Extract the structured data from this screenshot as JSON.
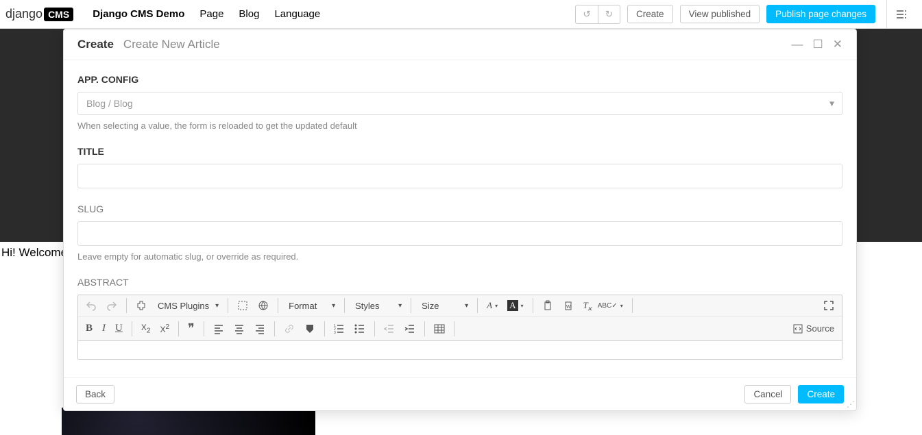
{
  "topbar": {
    "logo_text": "django",
    "logo_badge": "CMS",
    "nav": {
      "site_name": "Django CMS Demo",
      "page": "Page",
      "blog": "Blog",
      "language": "Language"
    },
    "buttons": {
      "create": "Create",
      "view_published": "View published",
      "publish": "Publish page changes"
    }
  },
  "page": {
    "welcome": "Hi! Welcome to"
  },
  "modal": {
    "title": "Create",
    "subtitle": "Create New Article",
    "footer": {
      "back": "Back",
      "cancel": "Cancel",
      "create": "Create"
    },
    "fields": {
      "app_config": {
        "label": "App. Config",
        "value": "Blog / Blog",
        "help": "When selecting a value, the form is reloaded to get the updated default"
      },
      "title": {
        "label": "Title"
      },
      "slug": {
        "label": "Slug",
        "help": "Leave empty for automatic slug, or override as required."
      },
      "abstract": {
        "label": "Abstract"
      }
    },
    "editor": {
      "cms_plugins": "CMS Plugins",
      "format": "Format",
      "styles": "Styles",
      "size": "Size",
      "source": "Source"
    }
  }
}
